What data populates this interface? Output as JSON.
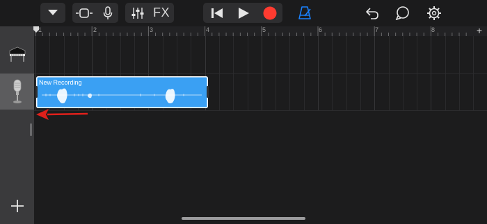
{
  "toolbar": {
    "icons": [
      "dropdown-triangle-icon",
      "track-view-icon",
      "microphone-icon",
      "mixer-sliders-icon",
      "rewind-icon",
      "play-icon",
      "record-icon",
      "metronome-icon",
      "undo-icon",
      "loop-icon",
      "settings-gear-icon"
    ],
    "fx_label": "FX",
    "colors": {
      "record": "#ff3b30",
      "metronome": "#1a82ff"
    }
  },
  "ruler": {
    "bars": [
      "1",
      "2",
      "3",
      "4",
      "5",
      "6",
      "7",
      "8"
    ],
    "add_label": "+"
  },
  "tracks": [
    {
      "instrument": "piano-icon"
    },
    {
      "instrument": "microphone-icon",
      "selected": true
    }
  ],
  "region": {
    "title": "New Recording",
    "color": "#3aa0f3"
  },
  "sidebar": {
    "add_track_label": "+"
  },
  "annotation": {
    "color": "#e0201b"
  }
}
